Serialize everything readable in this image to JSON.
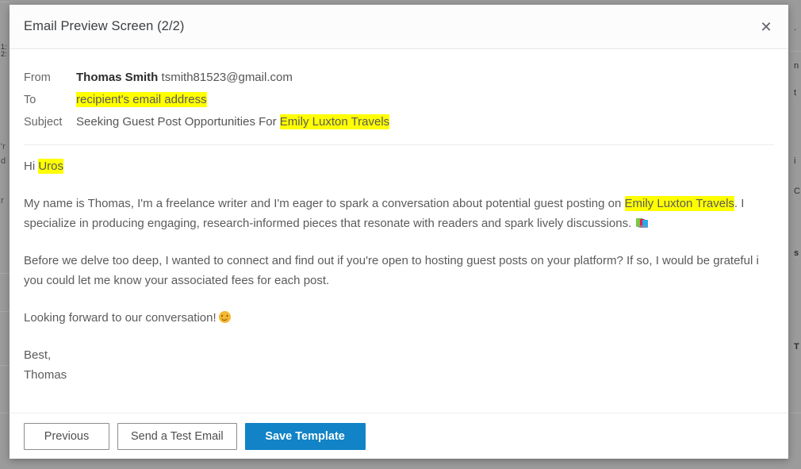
{
  "modal": {
    "title": "Email Preview Screen (2/2)",
    "close_icon": "close-icon",
    "close_glyph": "✕"
  },
  "email": {
    "fields": [
      {
        "label": "From",
        "sender_name": "Thomas Smith",
        "sender_email": "tsmith81523@gmail.com"
      },
      {
        "label": "To",
        "highlight": "recipient's email address"
      },
      {
        "label": "Subject",
        "text_before": "Seeking Guest Post Opportunities For ",
        "highlight": "Emily Luxton Travels"
      }
    ],
    "greeting": {
      "prefix": "Hi ",
      "highlight": "Uros"
    },
    "paragraph_1": {
      "part_1": "My name is Thomas, I'm a freelance writer and I'm eager to spark a conversation about potential guest posting on ",
      "highlight": "Emily Luxton Travels",
      "part_2": ". I specialize in producing engaging, research-informed pieces that resonate with readers and spark lively discussions. ",
      "emoji": "books-emoji"
    },
    "paragraph_2": "Before we delve too deep, I wanted to connect and find out if you're open to hosting guest posts on your platform? If so, I would be grateful i you could let me know your associated fees for each post.",
    "paragraph_3": {
      "text": "Looking forward to our conversation!",
      "emoji": "smiling-face-emoji"
    },
    "signoff": "Best,",
    "signature": "Thomas"
  },
  "footer": {
    "previous_label": "Previous",
    "test_email_label": "Send a Test Email",
    "save_template_label": "Save Template"
  },
  "colors": {
    "primary_button": "#1183c6",
    "highlight": "#ffff00",
    "modal_background": "#ffffff",
    "backdrop": "#9b9b9b",
    "body_text": "#5b5b5b"
  },
  "backdrop": {
    "left_fragments": [
      "1:",
      "2:",
      "'r",
      "d",
      "r"
    ],
    "right_fragments": [
      ".",
      "n",
      "t",
      "i",
      "C",
      "s",
      "T"
    ]
  }
}
